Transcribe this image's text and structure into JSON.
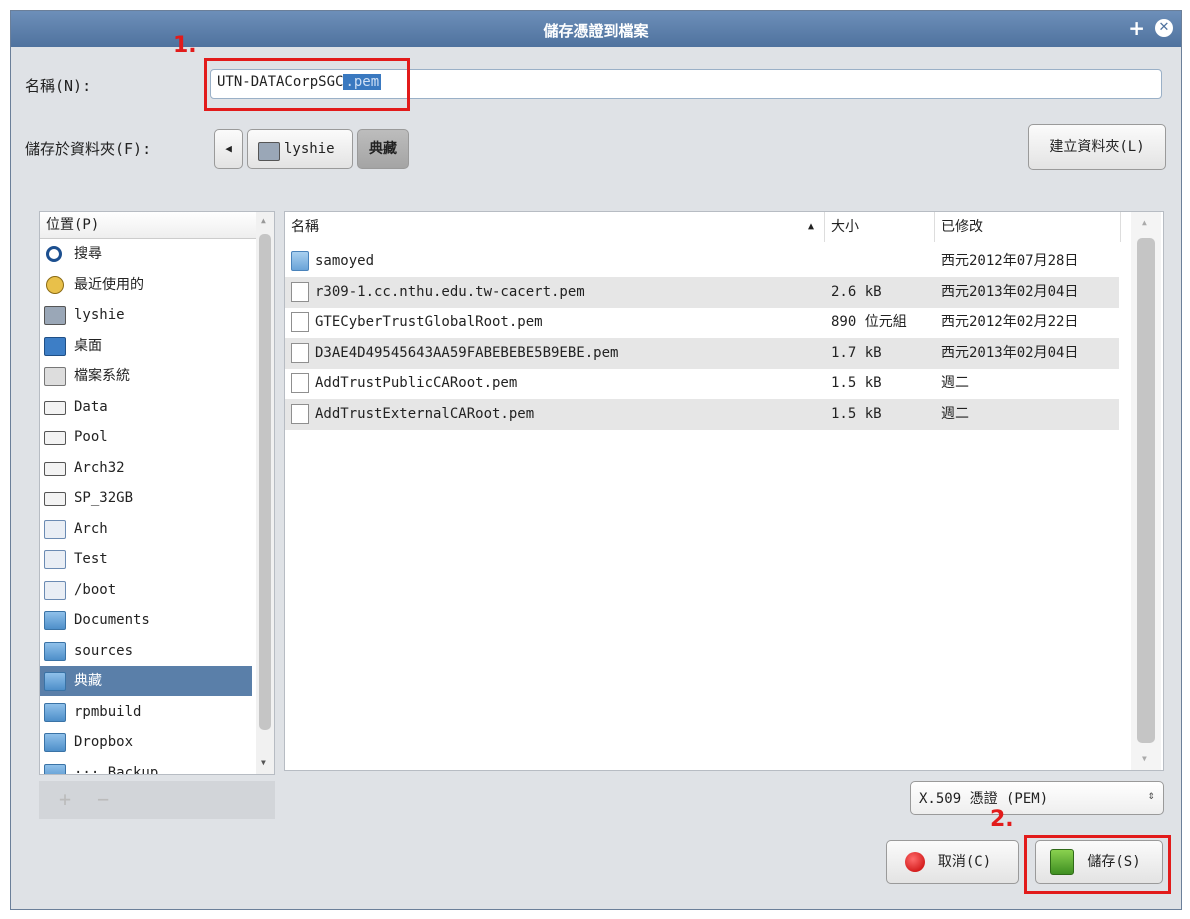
{
  "window": {
    "title": "儲存憑證到檔案",
    "plus_glyph": "+",
    "close_glyph": "✕"
  },
  "annotations": {
    "step1": "1.",
    "step2": "2."
  },
  "name_row": {
    "label": "名稱(N):",
    "value_main": "UTN-DATACorpSGC",
    "value_selected": ".pem"
  },
  "folder_row": {
    "label": "儲存於資料夾(F):",
    "back_glyph": "◀",
    "crumbs": [
      "lyshie",
      "典藏"
    ],
    "create_folder": "建立資料夾(L)"
  },
  "places": {
    "header": "位置(P)",
    "items": [
      {
        "label": "搜尋",
        "icon": "search-icon"
      },
      {
        "label": "最近使用的",
        "icon": "recent-icon"
      },
      {
        "label": "lyshie",
        "icon": "home-folder-icon"
      },
      {
        "label": "桌面",
        "icon": "desktop-icon"
      },
      {
        "label": "檔案系統",
        "icon": "filesystem-icon"
      },
      {
        "label": "Data",
        "icon": "drive-icon"
      },
      {
        "label": "Pool",
        "icon": "drive-icon"
      },
      {
        "label": "Arch32",
        "icon": "drive-icon"
      },
      {
        "label": "SP_32GB",
        "icon": "drive-icon"
      },
      {
        "label": "Arch",
        "icon": "usb-drive-icon"
      },
      {
        "label": "Test",
        "icon": "usb-drive-icon"
      },
      {
        "label": "/boot",
        "icon": "usb-drive-icon"
      },
      {
        "label": "Documents",
        "icon": "documents-folder-icon"
      },
      {
        "label": "sources",
        "icon": "folder-icon"
      },
      {
        "label": "典藏",
        "icon": "folder-icon"
      },
      {
        "label": "rpmbuild",
        "icon": "folder-icon"
      },
      {
        "label": "Dropbox",
        "icon": "folder-icon"
      },
      {
        "label": "··· Backup",
        "icon": "folder-icon"
      }
    ],
    "selected_index": 14,
    "add_glyph": "+",
    "remove_glyph": "−"
  },
  "files": {
    "columns": {
      "name": "名稱",
      "size": "大小",
      "modified": "已修改"
    },
    "sort_glyph": "▲",
    "rows": [
      {
        "name": "samoyed",
        "size": "",
        "modified": "西元2012年07月28日",
        "type": "folder"
      },
      {
        "name": "r309-1.cc.nthu.edu.tw-cacert.pem",
        "size": "2.6 kB",
        "modified": "西元2013年02月04日",
        "type": "file"
      },
      {
        "name": "GTECyberTrustGlobalRoot.pem",
        "size": "890 位元組",
        "modified": "西元2012年02月22日",
        "type": "file"
      },
      {
        "name": "D3AE4D49545643AA59FABEBEBE5B9EBE.pem",
        "size": "1.7 kB",
        "modified": "西元2013年02月04日",
        "type": "file"
      },
      {
        "name": "AddTrustPublicCARoot.pem",
        "size": "1.5 kB",
        "modified": "週二",
        "type": "file"
      },
      {
        "name": "AddTrustExternalCARoot.pem",
        "size": "1.5 kB",
        "modified": "週二",
        "type": "file"
      }
    ]
  },
  "filter": {
    "value": "X.509 憑證 (PEM)",
    "arrow": "⇕"
  },
  "actions": {
    "cancel": "取消(C)",
    "save": "儲存(S)"
  },
  "colors": {
    "annotation_red": "#e21b1b",
    "title_blue": "#4f729e",
    "selection_blue": "#5a7fa9"
  }
}
